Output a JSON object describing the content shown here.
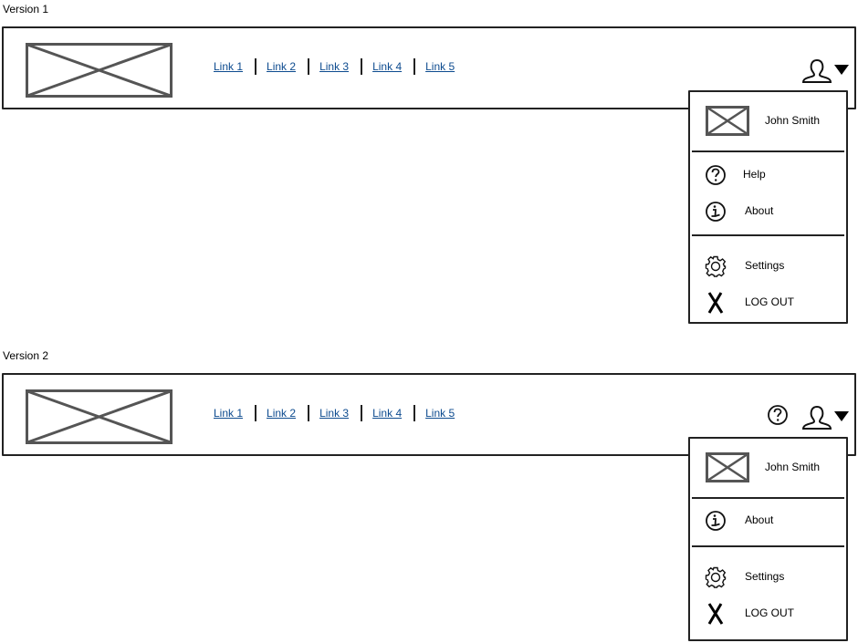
{
  "versions": [
    {
      "label": "Version 1",
      "nav_links": [
        "Link 1",
        "Link 2",
        "Link 3",
        "Link 4",
        "Link 5"
      ],
      "header_icons": [
        "user-icon",
        "caret-down-icon"
      ],
      "dropdown": {
        "user_name": "John Smith",
        "groups": [
          [
            {
              "label": "Help",
              "icon": "help-icon"
            },
            {
              "label": "About",
              "icon": "info-icon"
            }
          ],
          [
            {
              "label": "Settings",
              "icon": "gear-icon"
            },
            {
              "label": "LOG OUT",
              "icon": "close-icon"
            }
          ]
        ]
      }
    },
    {
      "label": "Version 2",
      "nav_links": [
        "Link 1",
        "Link 2",
        "Link 3",
        "Link 4",
        "Link 5"
      ],
      "header_icons": [
        "help-icon",
        "user-icon",
        "caret-down-icon"
      ],
      "dropdown": {
        "user_name": "John Smith",
        "groups": [
          [
            {
              "label": "About",
              "icon": "info-icon"
            }
          ],
          [
            {
              "label": "Settings",
              "icon": "gear-icon"
            },
            {
              "label": "LOG OUT",
              "icon": "close-icon"
            }
          ]
        ]
      }
    }
  ],
  "colors": {
    "link": "#0d4b8f",
    "stroke": "#222222",
    "placeholder": "#555555"
  }
}
